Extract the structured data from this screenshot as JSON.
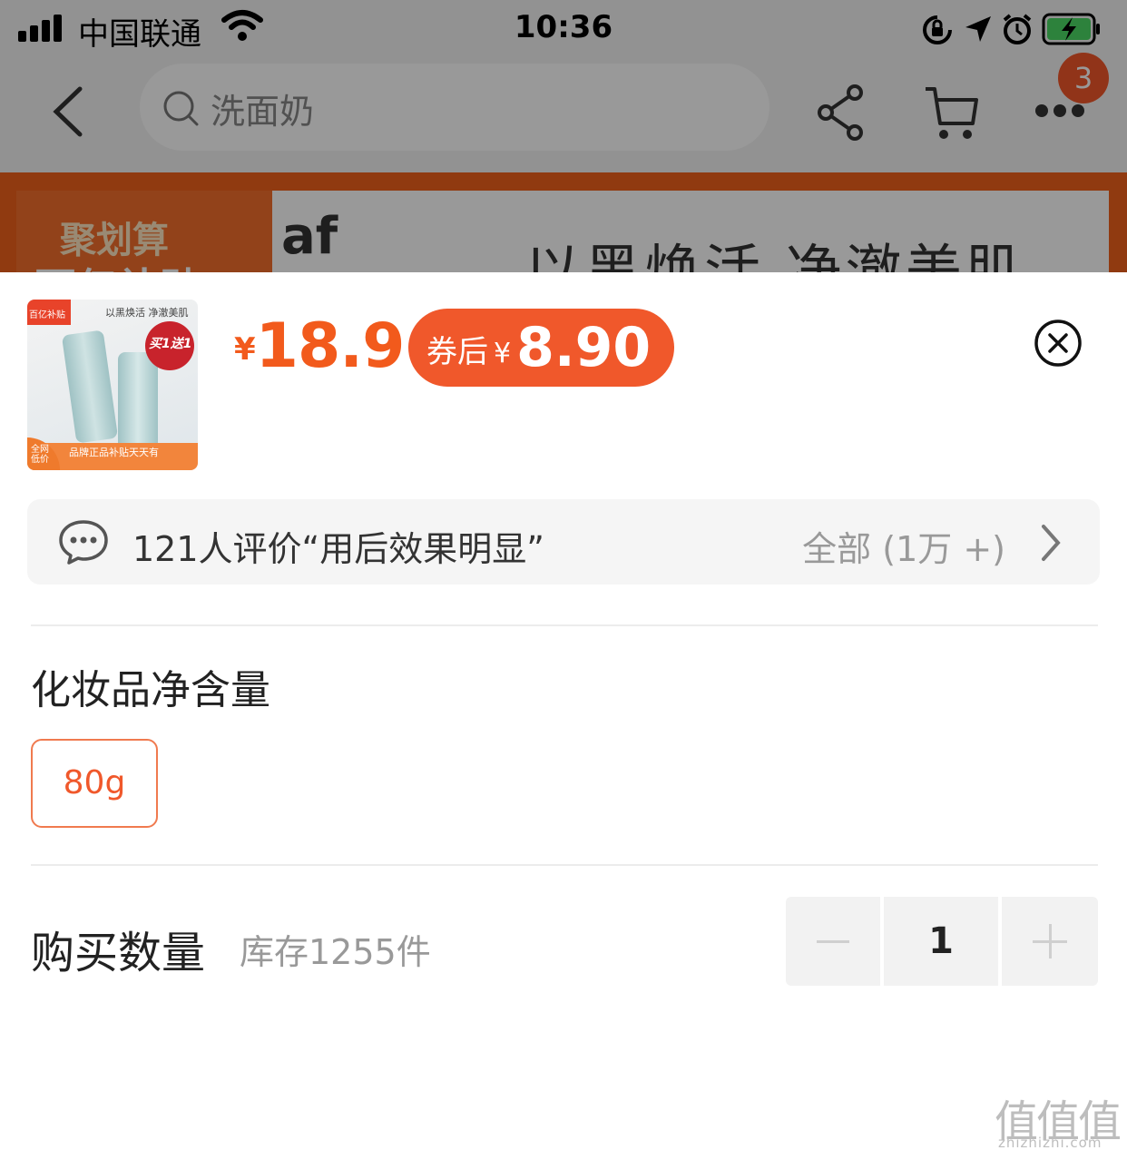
{
  "status_bar": {
    "carrier": "中国联通",
    "time": "10:36"
  },
  "nav": {
    "search_text": "洗面奶",
    "cart_badge": "3",
    "icons": [
      "back-icon",
      "search-icon",
      "share-icon",
      "cart-icon",
      "more-icon"
    ]
  },
  "banner": {
    "badge_line1": "聚划算",
    "badge_line2": "百亿补贴",
    "brand": "af",
    "slogan": "以黑焕活 净澈美肌"
  },
  "product": {
    "thumbnail": {
      "tag": "百亿补贴",
      "slogan": "以黑焕活 净澈美肌",
      "promo": "买1送1",
      "strip": "品牌正品补贴天天有",
      "corner": "全网低价"
    },
    "price_symbol": "¥",
    "price": "18.9",
    "coupon_label": "券后",
    "coupon_symbol": "¥",
    "coupon_price": "8.90"
  },
  "review": {
    "summary": "121人评价“用后效果明显”",
    "all_label": "全部 (1万 +)"
  },
  "spec": {
    "title": "化妆品净含量",
    "options": [
      "80g"
    ],
    "selected": "80g"
  },
  "quantity": {
    "title": "购买数量",
    "stock": "库存1255件",
    "value": "1"
  },
  "watermark": {
    "glyphs": "值值值",
    "url": "zhizhizhi.com"
  },
  "colors": {
    "accent": "#f25a1c",
    "coupon_bg": "#f0582b",
    "badge": "#f2582a"
  }
}
